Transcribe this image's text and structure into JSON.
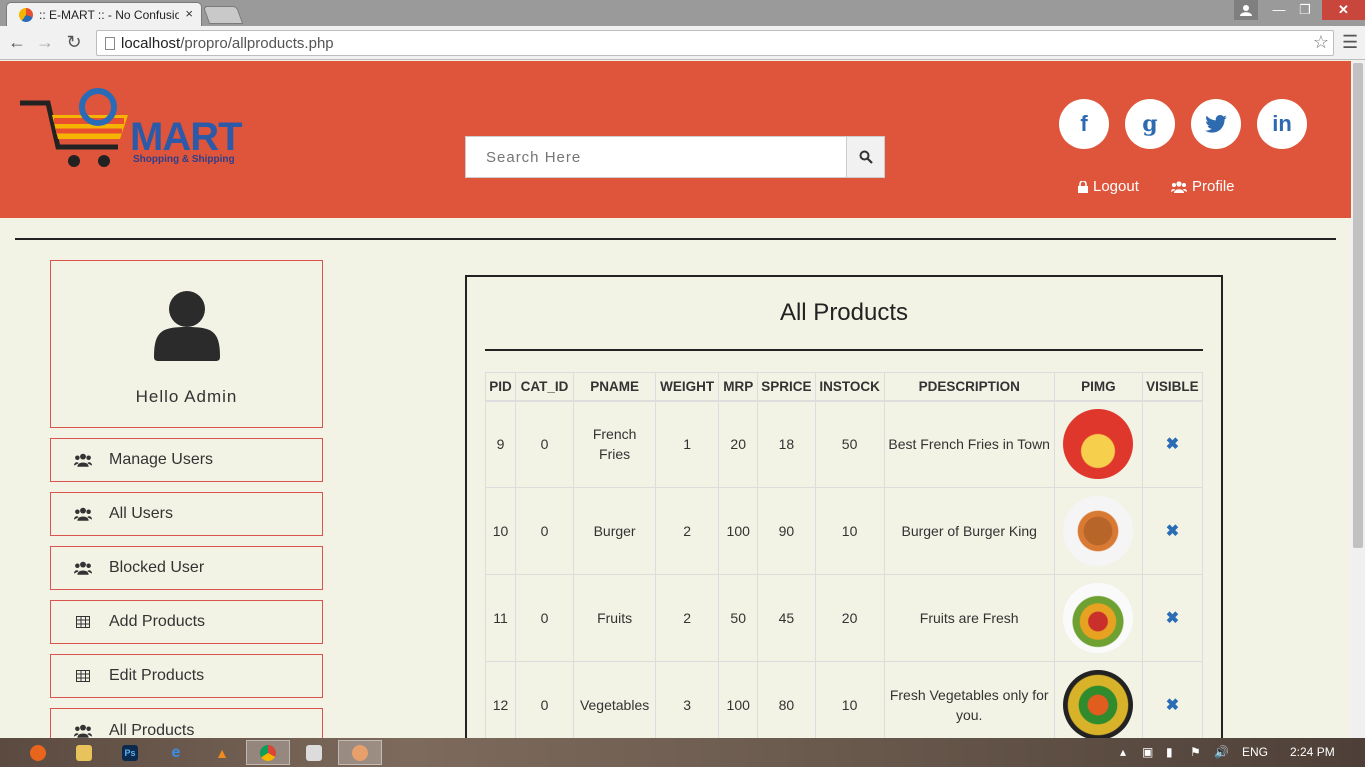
{
  "browser": {
    "tab_title": ":: E-MART :: - No Confusio",
    "tab_close": "×",
    "url_host": "localhost",
    "url_path": "/propro/allproducts.php"
  },
  "header": {
    "brand": "MART",
    "tagline": "Shopping & Shipping",
    "search_placeholder": "Search Here",
    "logout_label": "Logout",
    "profile_label": "Profile",
    "social": {
      "facebook": "f",
      "google": "g",
      "twitter": "twitter",
      "linkedin": "in"
    },
    "accent_color": "#df553b"
  },
  "sidebar": {
    "greeting": "Hello Admin",
    "items": [
      {
        "label": "Manage Users",
        "icon": "users-icon"
      },
      {
        "label": "All Users",
        "icon": "users-icon"
      },
      {
        "label": "Blocked User",
        "icon": "users-icon"
      },
      {
        "label": "Add Products",
        "icon": "table-icon"
      },
      {
        "label": "Edit Products",
        "icon": "table-icon"
      },
      {
        "label": "All Products",
        "icon": "users-icon"
      }
    ]
  },
  "products": {
    "title": "All Products",
    "columns": [
      "PID",
      "CAT_ID",
      "PNAME",
      "WEIGHT",
      "MRP",
      "SPRICE",
      "INSTOCK",
      "PDESCRIPTION",
      "PIMG",
      "VISIBLE"
    ],
    "rows": [
      {
        "pid": "9",
        "cat_id": "0",
        "pname": "French Fries",
        "weight": "1",
        "mrp": "20",
        "sprice": "18",
        "instock": "50",
        "pdescription": "Best French Fries in Town",
        "img": "fries",
        "visible": "✖"
      },
      {
        "pid": "10",
        "cat_id": "0",
        "pname": "Burger",
        "weight": "2",
        "mrp": "100",
        "sprice": "90",
        "instock": "10",
        "pdescription": "Burger of Burger King",
        "img": "burger",
        "visible": "✖"
      },
      {
        "pid": "11",
        "cat_id": "0",
        "pname": "Fruits",
        "weight": "2",
        "mrp": "50",
        "sprice": "45",
        "instock": "20",
        "pdescription": "Fruits are Fresh",
        "img": "fruits",
        "visible": "✖"
      },
      {
        "pid": "12",
        "cat_id": "0",
        "pname": "Vegetables",
        "weight": "3",
        "mrp": "100",
        "sprice": "80",
        "instock": "10",
        "pdescription": "Fresh Vegetables only for you.",
        "img": "veg",
        "visible": "✖"
      }
    ]
  },
  "taskbar": {
    "apps": [
      "firefox",
      "explorer",
      "photoshop",
      "internet-explorer",
      "vlc",
      "chrome",
      "window",
      "paint"
    ],
    "lang": "ENG",
    "time": "2:24 PM"
  }
}
